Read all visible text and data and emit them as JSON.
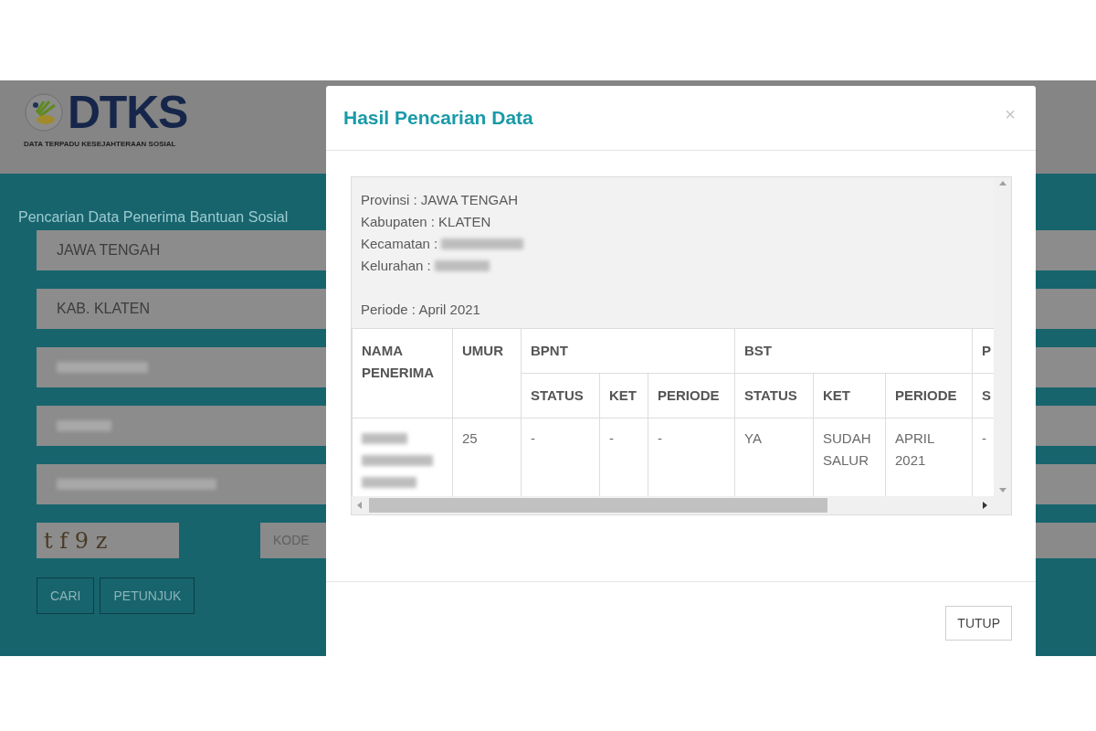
{
  "logo": {
    "brand": "DTKS",
    "tagline": "DATA TERPADU KESEJAHTERAAN SOSIAL"
  },
  "search_form": {
    "title": "Pencarian Data Penerima Bantuan Sosial",
    "fields": [
      {
        "kind": "text",
        "value": "JAWA TENGAH"
      },
      {
        "kind": "text",
        "value": "KAB. KLATEN"
      },
      {
        "kind": "redacted"
      },
      {
        "kind": "redacted"
      },
      {
        "kind": "redacted"
      }
    ],
    "captcha": "t f 9 z",
    "code_field": {
      "placeholder": "KODE"
    },
    "buttons": [
      "CARI",
      "PETUNJUK"
    ]
  },
  "modal": {
    "title": "Hasil Pencarian Data",
    "close": "×",
    "info": [
      {
        "kind": "text",
        "label": "Provinsi : JAWA TENGAH"
      },
      {
        "kind": "text",
        "label": "Kabupaten : KLATEN"
      },
      {
        "kind": "redacted",
        "label": "Kecamatan :"
      },
      {
        "kind": "redacted",
        "label": "Kelurahan :"
      },
      {
        "kind": "text",
        "label": "Periode : April 2021"
      }
    ],
    "table": {
      "header_rows": [
        [
          {
            "label": "NAMA PENERIMA",
            "rowspan": 2
          },
          {
            "label": "UMUR",
            "rowspan": 2
          },
          {
            "label": "BPNT",
            "colspan": 3
          },
          {
            "label": "BST",
            "colspan": 3
          },
          {
            "label": "P"
          }
        ],
        [
          {
            "label": "STATUS"
          },
          {
            "label": "KET"
          },
          {
            "label": "PERIODE"
          },
          {
            "label": "STATUS"
          },
          {
            "label": "KET"
          },
          {
            "label": "PERIODE"
          },
          {
            "label": "S"
          }
        ]
      ],
      "rows": [
        {
          "cells": [
            {
              "kind": "redacted"
            },
            {
              "kind": "text",
              "text": "25"
            },
            {
              "kind": "text",
              "text": "-"
            },
            {
              "kind": "text",
              "text": "-"
            },
            {
              "kind": "text",
              "text": "-"
            },
            {
              "kind": "text",
              "text": "YA"
            },
            {
              "kind": "text",
              "text": "SUDAH SALUR"
            },
            {
              "kind": "text",
              "text": "APRIL 2021"
            },
            {
              "kind": "text",
              "text": "-"
            }
          ]
        }
      ]
    },
    "buttons": [
      "TUTUP"
    ]
  }
}
